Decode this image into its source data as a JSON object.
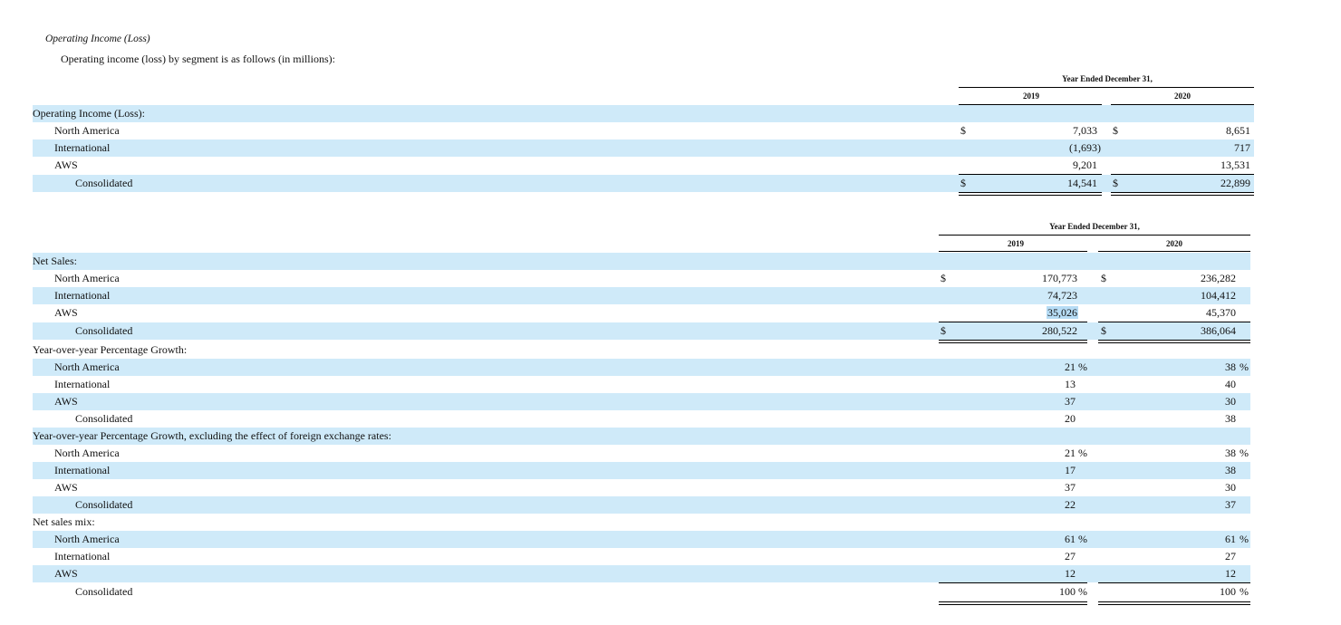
{
  "intro": {
    "title": "Operating Income (Loss)",
    "text": "Operating income (loss) by segment is as follows (in millions):"
  },
  "colors": {
    "band": "#cfeaf9",
    "highlight": "#b6dcf5"
  },
  "table1": {
    "header": {
      "title": "Year Ended December 31,",
      "year1": "2019",
      "year2": "2020"
    },
    "section": "Operating Income (Loss):",
    "rows": [
      {
        "label": "North America",
        "dollar": "$",
        "v2019": "7,033",
        "dollar2": "$",
        "v2020": "8,651"
      },
      {
        "label": "International",
        "dollar": "",
        "v2019": "(1,693)",
        "dollar2": "",
        "v2020": "717"
      },
      {
        "label": "AWS",
        "dollar": "",
        "v2019": "9,201",
        "dollar2": "",
        "v2020": "13,531"
      },
      {
        "label": "Consolidated",
        "dollar": "$",
        "v2019": "14,541",
        "dollar2": "$",
        "v2020": "22,899"
      }
    ]
  },
  "table2": {
    "header": {
      "title": "Year Ended December 31,",
      "year1": "2019",
      "year2": "2020"
    },
    "net_sales": {
      "section": "Net Sales:",
      "rows": [
        {
          "label": "North America",
          "dollar": "$",
          "v2019": "170,773",
          "dollar2": "$",
          "v2020": "236,282"
        },
        {
          "label": "International",
          "v2019": "74,723",
          "v2020": "104,412"
        },
        {
          "label": "AWS",
          "v2019": "35,026",
          "v2020": "45,370"
        },
        {
          "label": "Consolidated",
          "dollar": "$",
          "v2019": "280,522",
          "dollar2": "$",
          "v2020": "386,064"
        }
      ]
    },
    "yoy": {
      "section": "Year-over-year Percentage Growth:",
      "rows": [
        {
          "label": "North America",
          "v2019": "21",
          "v2020": "38",
          "pct": "%"
        },
        {
          "label": "International",
          "v2019": "13",
          "v2020": "40"
        },
        {
          "label": "AWS",
          "v2019": "37",
          "v2020": "30"
        },
        {
          "label": "Consolidated",
          "v2019": "20",
          "v2020": "38"
        }
      ]
    },
    "yoy_fx": {
      "section": "Year-over-year Percentage Growth, excluding the effect of foreign exchange rates:",
      "rows": [
        {
          "label": "North America",
          "v2019": "21",
          "v2020": "38",
          "pct": "%"
        },
        {
          "label": "International",
          "v2019": "17",
          "v2020": "38"
        },
        {
          "label": "AWS",
          "v2019": "37",
          "v2020": "30"
        },
        {
          "label": "Consolidated",
          "v2019": "22",
          "v2020": "37"
        }
      ]
    },
    "mix": {
      "section": "Net sales mix:",
      "rows": [
        {
          "label": "North America",
          "v2019": "61",
          "v2020": "61",
          "pct": "%"
        },
        {
          "label": "International",
          "v2019": "27",
          "v2020": "27"
        },
        {
          "label": "AWS",
          "v2019": "12",
          "v2020": "12"
        },
        {
          "label": "Consolidated",
          "v2019": "100",
          "v2020": "100",
          "pct": "%"
        }
      ]
    }
  }
}
